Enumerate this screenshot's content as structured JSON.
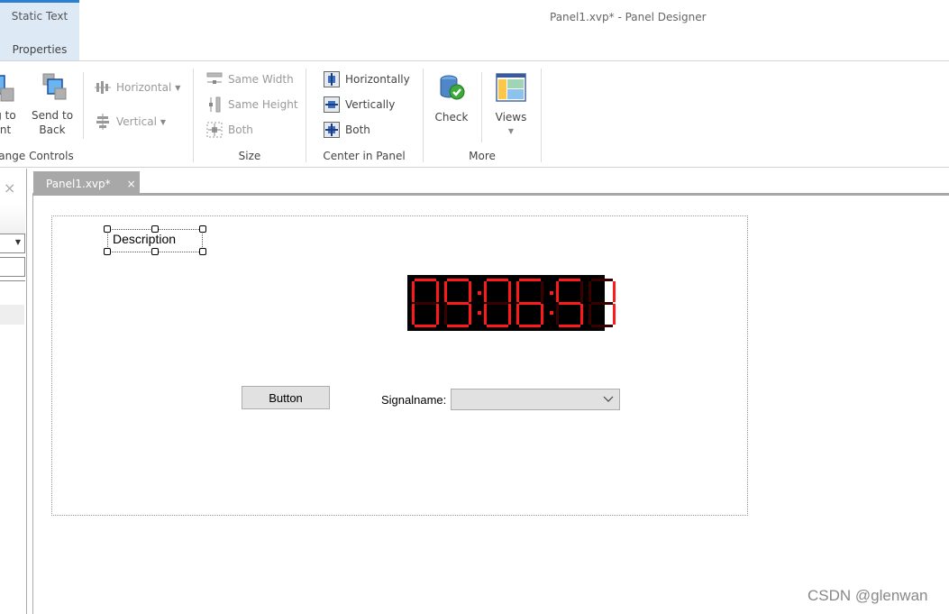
{
  "window": {
    "title": "Panel1.xvp* - Panel Designer"
  },
  "context_tab": {
    "label": "Static Text",
    "sub_label": "Properties",
    "accent": "#2b7fd3"
  },
  "ribbon": {
    "arrange": {
      "label": "Arrange Controls",
      "label_visible": "ange Controls",
      "bring_front": {
        "line1": "g to",
        "line2": "nt"
      },
      "send_back": {
        "line1": "Send to",
        "line2": "Back"
      },
      "horizontal": "Horizontal",
      "vertical": "Vertical"
    },
    "size": {
      "label": "Size",
      "same_width": "Same Width",
      "same_height": "Same Height",
      "both": "Both"
    },
    "center": {
      "label": "Center in Panel",
      "horizontally": "Horizontally",
      "vertically": "Vertically",
      "both": "Both"
    },
    "more": {
      "label": "More",
      "check": "Check",
      "views": "Views"
    }
  },
  "document_tab": {
    "label": "Panel1.xvp*",
    "close": "×"
  },
  "left_panel": {
    "close": "×"
  },
  "panel": {
    "description": "Description",
    "clock": {
      "value": "09:06:51",
      "on_color": "#ff1a1a",
      "off_color": "#3a0000"
    },
    "button_label": "Button",
    "signal_label": "Signalname:",
    "signal_value": ""
  },
  "watermark": "CSDN @glenwan"
}
